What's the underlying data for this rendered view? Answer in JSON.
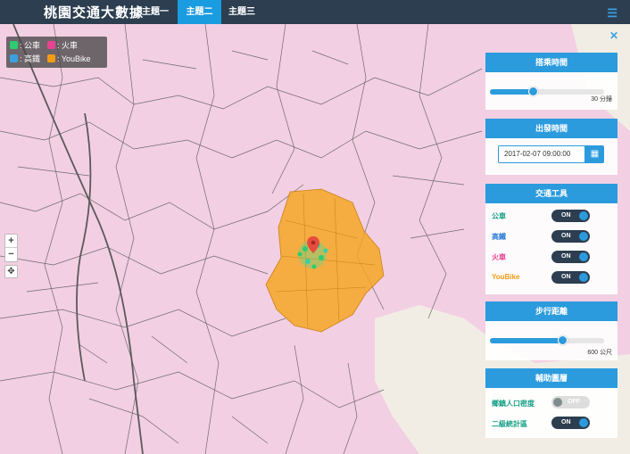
{
  "brand": "桃園交通大數據",
  "tabs": [
    "主題一",
    "主題二",
    "主題三"
  ],
  "active_tab": 1,
  "legend": [
    {
      "label": "公車",
      "color": "#2ecc71"
    },
    {
      "label": "火車",
      "color": "#e84393"
    },
    {
      "label": "高鐵",
      "color": "#3aa0e0"
    },
    {
      "label": "YouBike",
      "color": "#f39c12"
    }
  ],
  "panel": {
    "close_label": "✕",
    "travel_time": {
      "title": "搭乘時間",
      "value_label": "30 分鐘",
      "fraction": 0.38
    },
    "departure": {
      "title": "出發時間",
      "datetime": "2017-02-07 09:00:00",
      "calendar_icon": "calendar-icon"
    },
    "transport": {
      "title": "交通工具",
      "items": [
        {
          "label": "公車",
          "state": "ON",
          "color": "#16a085"
        },
        {
          "label": "高鐵",
          "state": "ON",
          "color": "#2b7cd3"
        },
        {
          "label": "火車",
          "state": "ON",
          "color": "#e83e8c"
        },
        {
          "label": "YouBike",
          "state": "ON",
          "color": "#f39c12"
        }
      ]
    },
    "walk_distance": {
      "title": "步行距離",
      "value_label": "600 公尺",
      "fraction": 0.63
    },
    "auxiliary": {
      "title": "輔助圖層",
      "items": [
        {
          "label": "鄉鎮人口密度",
          "state": "OFF",
          "color": "#16a085"
        },
        {
          "label": "二級統計區",
          "state": "ON",
          "color": "#16a085"
        }
      ]
    }
  },
  "map": {
    "zoom_in": "+",
    "zoom_out": "−",
    "locate": "✥",
    "isochrone_color": "#f5a623",
    "region_color": "#f3cfe3"
  }
}
